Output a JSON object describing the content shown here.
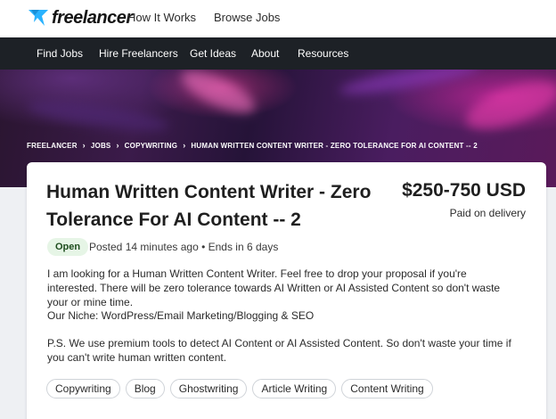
{
  "header": {
    "logo_text": "freelancer",
    "links": [
      "How It Works",
      "Browse Jobs"
    ]
  },
  "nav": {
    "items": [
      "Find Jobs",
      "Hire Freelancers",
      "Get Ideas",
      "About",
      "Resources"
    ]
  },
  "breadcrumb": [
    "FREELANCER",
    "JOBS",
    "COPYWRITING",
    "HUMAN WRITTEN CONTENT WRITER - ZERO TOLERANCE FOR AI CONTENT -- 2"
  ],
  "project": {
    "title": "Human Written Content Writer - Zero Tolerance For AI Content -- 2",
    "price": "$250-750 USD",
    "payment": "Paid on delivery",
    "status": "Open",
    "meta": "Posted 14 minutes ago • Ends in 6 days",
    "description": [
      "I am looking for a Human Written Content Writer. Feel free to drop your proposal if you're interested. There will be zero tolerance towards AI Written or AI Assisted Content so don't waste your or mine time.",
      "Our Niche: WordPress/Email Marketing/Blogging & SEO",
      "P.S. We use premium tools to detect AI Content or AI Assisted Content. So don't waste your time if you can't write human written content."
    ],
    "tags": [
      "Copywriting",
      "Blog",
      "Ghostwriting",
      "Article Writing",
      "Content Writing"
    ]
  },
  "colors": {
    "nav_bg": "#1d2126",
    "logo_blue": "#29b2fe",
    "open_badge_bg": "#e6f5e6"
  }
}
